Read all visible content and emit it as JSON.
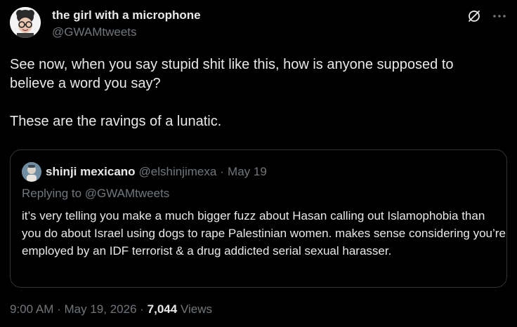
{
  "author": {
    "display_name": "the girl with a microphone",
    "handle": "@GWAMtweets"
  },
  "tweet": {
    "paragraphs": [
      "See now, when you say stupid shit like this, how is anyone supposed to believe a word you say?",
      "These are the ravings of a lunatic."
    ]
  },
  "quoted": {
    "display_name": "shinji mexicano",
    "handle": "@elshinjimexa",
    "separator": "·",
    "date": "May 19",
    "replying_to": "Replying to @GWAMtweets",
    "text": "it’s very telling you make a much bigger fuzz about Hasan calling out Islamophobia than you do about Israel using dogs to rape Palestinian women. makes sense considering you’re employed by an IDF terrorist & a drug addicted serial sexual harasser."
  },
  "meta": {
    "time": "9:00 AM",
    "separator": "·",
    "date": "May 19, 2026",
    "views_count": "7,044",
    "views_label": "Views"
  },
  "icons": {
    "grok": "grok-slash-icon",
    "more": "more-dots-icon"
  },
  "colors": {
    "background": "#000000",
    "primary_text": "#e7e9ea",
    "secondary_text": "#71767b",
    "border": "#2f3336"
  }
}
